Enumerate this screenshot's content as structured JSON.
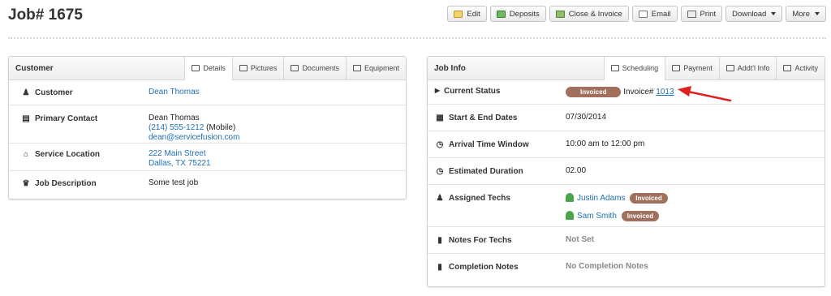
{
  "page": {
    "title": "Job# 1675"
  },
  "toolbar": {
    "edit": "Edit",
    "deposits": "Deposits",
    "close_invoice": "Close & Invoice",
    "email": "Email",
    "print": "Print",
    "download": "Download",
    "more": "More"
  },
  "customer_panel": {
    "title": "Customer",
    "tabs": [
      "Details",
      "Pictures",
      "Documents",
      "Equipment"
    ],
    "customer": {
      "label": "Customer",
      "value": "Dean Thomas"
    },
    "primary_contact": {
      "label": "Primary Contact",
      "name": "Dean Thomas",
      "phone": "(214) 555-1212",
      "phone_type": "(Mobile)",
      "email": "dean@servicefusion.com"
    },
    "service_location": {
      "label": "Service Location",
      "line1": "222 Main Street",
      "line2": "Dallas, TX 75221"
    },
    "job_description": {
      "label": "Job Description",
      "value": "Some test job"
    }
  },
  "job_panel": {
    "title": "Job Info",
    "tabs": [
      "Scheduling",
      "Payment",
      "Addt'l Info",
      "Activity"
    ],
    "current_status": {
      "label": "Current Status",
      "badge": "Invoiced",
      "invoice_prefix": "Invoice#",
      "invoice_number": "1013"
    },
    "dates": {
      "label": "Start & End Dates",
      "value": "07/30/2014"
    },
    "arrival": {
      "label": "Arrival Time Window",
      "value": "10:00 am to 12:00 pm"
    },
    "duration": {
      "label": "Estimated Duration",
      "value": "02.00"
    },
    "techs": {
      "label": "Assigned Techs",
      "list": [
        {
          "name": "Justin Adams",
          "status": "Invoiced"
        },
        {
          "name": "Sam Smith",
          "status": "Invoiced"
        }
      ]
    },
    "notes_techs": {
      "label": "Notes For Techs",
      "value": "Not Set"
    },
    "completion_notes": {
      "label": "Completion Notes",
      "value": "No Completion Notes"
    }
  },
  "colors": {
    "link": "#1f6fb2",
    "badge": "#a0705d",
    "arrow": "#e02020"
  }
}
